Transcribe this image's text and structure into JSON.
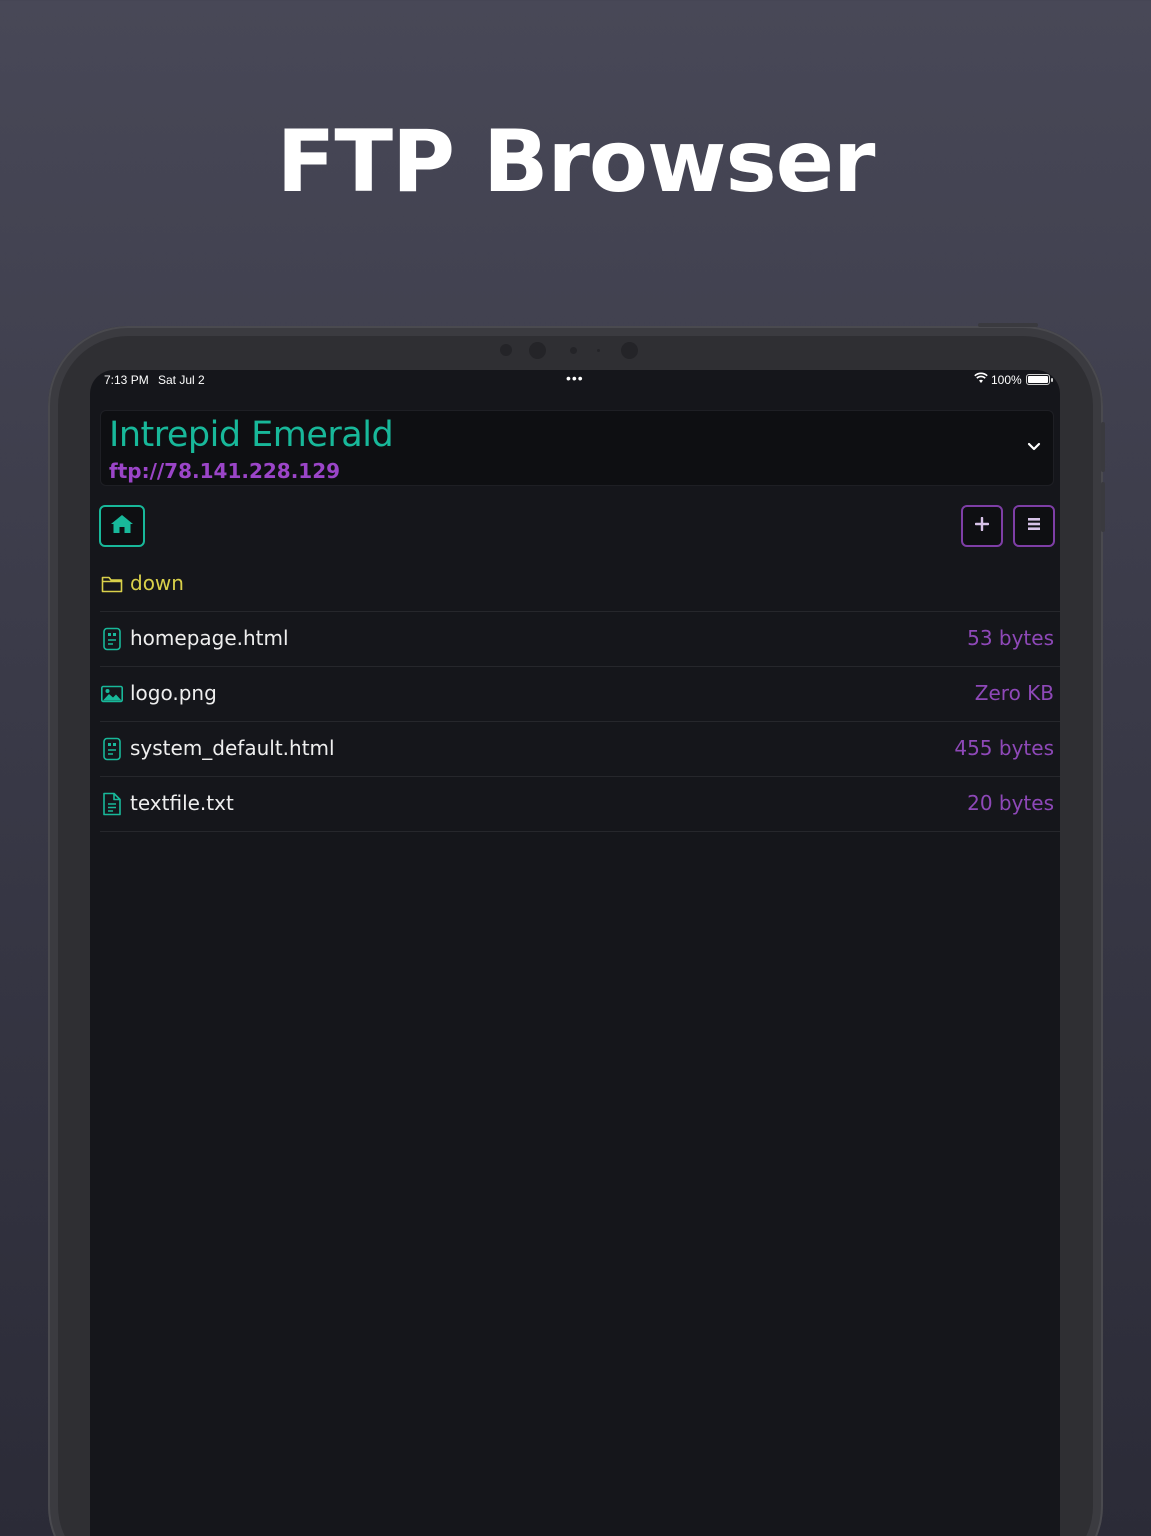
{
  "promo": {
    "headline": "FTP Browser"
  },
  "status_bar": {
    "time": "7:13 PM",
    "date": "Sat Jul 2",
    "multitask_dots": "•••",
    "battery_percent": "100%",
    "icons": [
      "wifi-icon",
      "battery-icon"
    ]
  },
  "server": {
    "name": "Intrepid Emerald",
    "url": "ftp://78.141.228.129",
    "dropdown_icon": "chevron-down-icon"
  },
  "toolbar": {
    "home_icon": "home-icon",
    "add_icon": "plus-icon",
    "menu_icon": "list-icon"
  },
  "files": [
    {
      "name": "down",
      "size": "",
      "type": "folder",
      "icon": "folder-icon"
    },
    {
      "name": "homepage.html",
      "size": "53 bytes",
      "type": "html",
      "icon": "html-file-icon"
    },
    {
      "name": "logo.png",
      "size": "Zero KB",
      "type": "image",
      "icon": "image-file-icon"
    },
    {
      "name": "system_default.html",
      "size": "455 bytes",
      "type": "html",
      "icon": "html-file-icon"
    },
    {
      "name": "textfile.txt",
      "size": "20 bytes",
      "type": "text",
      "icon": "text-file-icon"
    }
  ],
  "colors": {
    "accent_teal": "#18b89a",
    "accent_purple": "#9b45c8",
    "folder_yellow": "#d9d04a",
    "background": "#15161b"
  }
}
